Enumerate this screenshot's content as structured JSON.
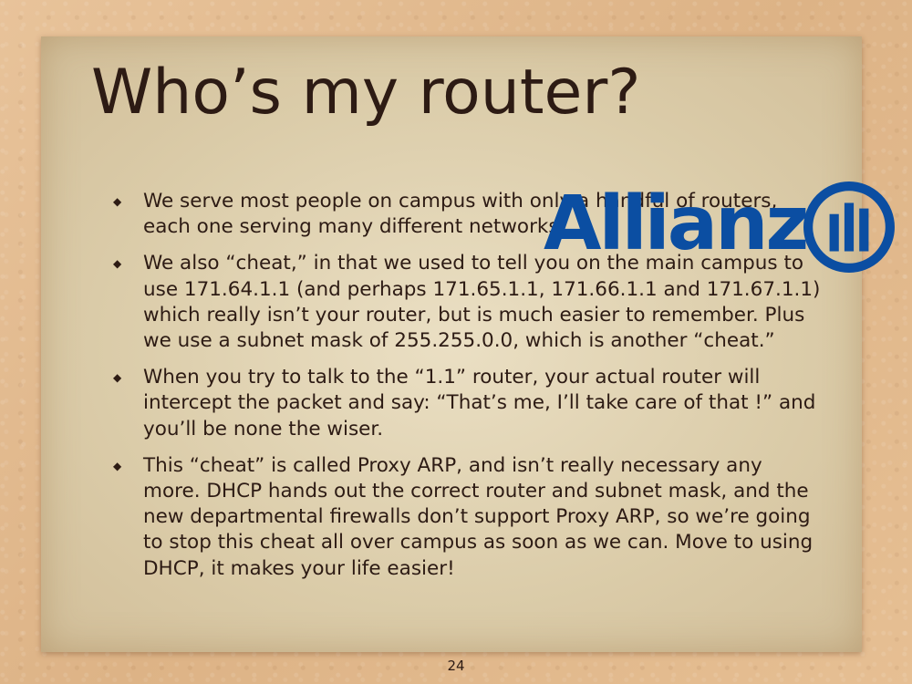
{
  "slide": {
    "title": "Who’s my router?",
    "bullets": [
      "We serve most people on campus with only a handful of routers, each one serving many different networks.",
      "We also “cheat,” in that we used to tell you on the main campus to use 171.64.1.1 (and perhaps 171.65.1.1, 171.66.1.1 and 171.67.1.1) which really isn’t your router, but is much easier to remember. Plus we use a subnet mask of 255.255.0.0, which is another “cheat.”",
      "When you try to talk to the “1.1” router, your actual router will intercept the packet and say: “That’s me, I’ll take care of that !” and you’ll be none the wiser.",
      "This “cheat” is called Proxy ARP, and isn’t really necessary any more. DHCP hands out the correct router and subnet mask, and the new departmental firewalls don’t support Proxy ARP, so we’re going to stop this cheat all over campus as soon as we can. Move to using DHCP, it makes your life easier!"
    ],
    "bullet_marker": "◆",
    "page_number": "24"
  },
  "logo": {
    "text": "Allianz",
    "icon": "allianz-logo-icon",
    "color": "#0b4ea2"
  },
  "colors": {
    "text": "#2d1b14",
    "card": "#dacba8",
    "background": "#e3bd92"
  }
}
